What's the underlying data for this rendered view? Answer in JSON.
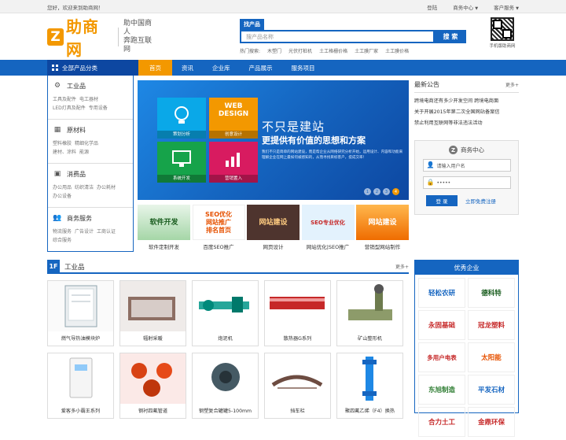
{
  "topbar": {
    "welcome": "您好，欢迎来到助商网！",
    "login": "登陆",
    "business_center": "商务中心",
    "customer_service": "客户服务"
  },
  "header": {
    "logo_letter": "Z",
    "logo_name": "助商网",
    "slogan_line1": "助中国商人",
    "slogan_line2": "奔跑互联网",
    "search_tab": "找产品",
    "search_placeholder": "搜产品名称",
    "search_button": "搜 索",
    "hot_label": "热门搜索:",
    "hot_terms": [
      "木塑门",
      "光伏打桩机",
      "土工格栅价格",
      "土工膜厂家",
      "土工膜价格"
    ],
    "qr_label": "手机版助商网"
  },
  "nav": {
    "all_categories": "全部产品分类",
    "items": [
      "首页",
      "资讯",
      "企业库",
      "产品展示",
      "服务项目"
    ]
  },
  "categories": [
    {
      "title": "工业品",
      "icon": "gears-icon",
      "subs": [
        "工具及配件",
        "电工器材",
        "LED灯具及配件",
        "专用设备"
      ]
    },
    {
      "title": "原材料",
      "icon": "cubes-icon",
      "subs": [
        "塑料橡胶",
        "精细化学品",
        "建材、涂料",
        "能源"
      ]
    },
    {
      "title": "消费品",
      "icon": "bag-icon",
      "subs": [
        "办公用品",
        "纺织清洁",
        "办公耗材",
        "办公设备"
      ]
    },
    {
      "title": "商务服务",
      "icon": "users-icon",
      "subs": [
        "物流服务",
        "广告设计",
        "工商认证",
        "综合服务"
      ]
    }
  ],
  "banner": {
    "tiles": [
      "策划分析",
      "创意设计",
      "系统开发",
      "营销置入"
    ],
    "web_design": "WEB\nDESIGN",
    "headline": "不只是建站",
    "subheadline": "更提供有价值的思想和方案",
    "paragraph": "我们不只是简单的网站建设，而是帮企业从网络研究分析开始，运用设计、内容和功能来理解企业在网上最如何被感知的，从而寻找目标客户，提成交率！",
    "dots": [
      "1",
      "2",
      "3",
      "4"
    ],
    "active_dot": 3
  },
  "thumbs": [
    {
      "caption": "软件定制开发",
      "art": "软件开发",
      "bg": "#2e7d32"
    },
    {
      "caption": "百度SEO推广",
      "art": "SEO优化\n网站推广\n排名首页",
      "bg": "#ffffff"
    },
    {
      "caption": "网页设计",
      "art": "网站建设",
      "bg": "#3e2723"
    },
    {
      "caption": "网站优化|SEO推广",
      "art": "SEO专业优化",
      "bg": "#e3f2fd"
    },
    {
      "caption": "营销型网站制作",
      "art": "网站建设",
      "bg": "#ff8f00"
    }
  ],
  "news": {
    "title": "最新公告",
    "more": "更多+",
    "items": [
      "跨境电商还有多少开发空间 跨境电商面",
      "关于开展2015年第二次全国网站备案信",
      "禁止利用互联网等非法违法活动"
    ]
  },
  "member": {
    "title": "商务中心",
    "user_placeholder": "请输入用户名",
    "password_mask": "•••••",
    "login_button": "登 录",
    "register": "立即免费注册"
  },
  "floor": {
    "number": "1F",
    "title": "工业品",
    "more": "更多+",
    "products": [
      "燃气导热油模块炉",
      "辐射采暖",
      "炮泥机",
      "散热器G系列",
      "矿山整形机",
      "爱客多小霸王系列",
      "钢衬四氟管道",
      "钢塑复合罐罐5-100mm",
      "挡车栏",
      "聚四氟乙烯（F4）换热"
    ]
  },
  "firms": {
    "title": "优秀企业",
    "items": [
      {
        "name": "轻松农研",
        "color": "#1565c0"
      },
      {
        "name": "德科特",
        "color": "#1b5e20"
      },
      {
        "name": "永固基础",
        "color": "#c62828"
      },
      {
        "name": "冠龙塑料",
        "color": "#c62828"
      },
      {
        "name": "多用户电表",
        "color": "#c62828"
      },
      {
        "name": "太阳能",
        "color": "#e65100"
      },
      {
        "name": "东旭制造",
        "color": "#2e7d32"
      },
      {
        "name": "平发石材",
        "color": "#1565c0"
      },
      {
        "name": "合力土工",
        "color": "#c62828"
      },
      {
        "name": "金鼎环保",
        "color": "#c62828"
      }
    ]
  }
}
